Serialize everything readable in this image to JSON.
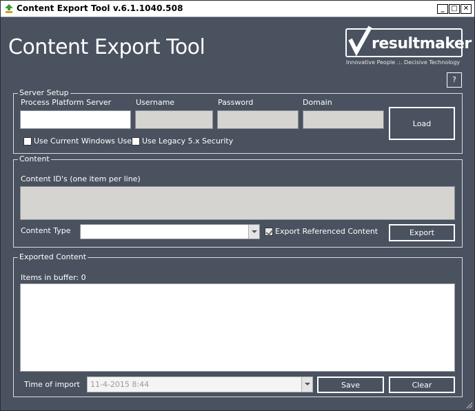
{
  "window": {
    "title": "Content Export Tool v.6.1.1040.508",
    "minimize": "_",
    "maximize": "□",
    "close": "✕"
  },
  "header": {
    "app_title": "Content Export Tool",
    "logo_name": "resultmaker",
    "logo_tagline": "Innovative People .:. Decisive Technology",
    "help_label": "?"
  },
  "server_setup": {
    "legend": "Server Setup",
    "server_label": "Process Platform Server",
    "server_value": "",
    "username_label": "Username",
    "username_value": "",
    "password_label": "Password",
    "password_value": "",
    "domain_label": "Domain",
    "domain_value": "",
    "load_label": "Load",
    "use_windows_user_label": "Use Current Windows User",
    "use_windows_user_checked": false,
    "use_legacy_label": "Use Legacy 5.x Security",
    "use_legacy_checked": false
  },
  "content": {
    "legend": "Content",
    "ids_label": "Content ID's (one item per line)",
    "ids_value": "",
    "type_label": "Content Type",
    "type_value": "",
    "export_referenced_label": "Export Referenced Content",
    "export_referenced_checked": true,
    "export_label": "Export"
  },
  "exported": {
    "legend": "Exported Content",
    "items_label": "Items in buffer: 0",
    "buffer_value": "",
    "time_label": "Time of import",
    "time_value": "11-4-2015 8:44",
    "save_label": "Save",
    "clear_label": "Clear"
  },
  "colors": {
    "background": "#4a5260",
    "field_disabled": "#d6d4d0",
    "text": "#ffffff"
  }
}
